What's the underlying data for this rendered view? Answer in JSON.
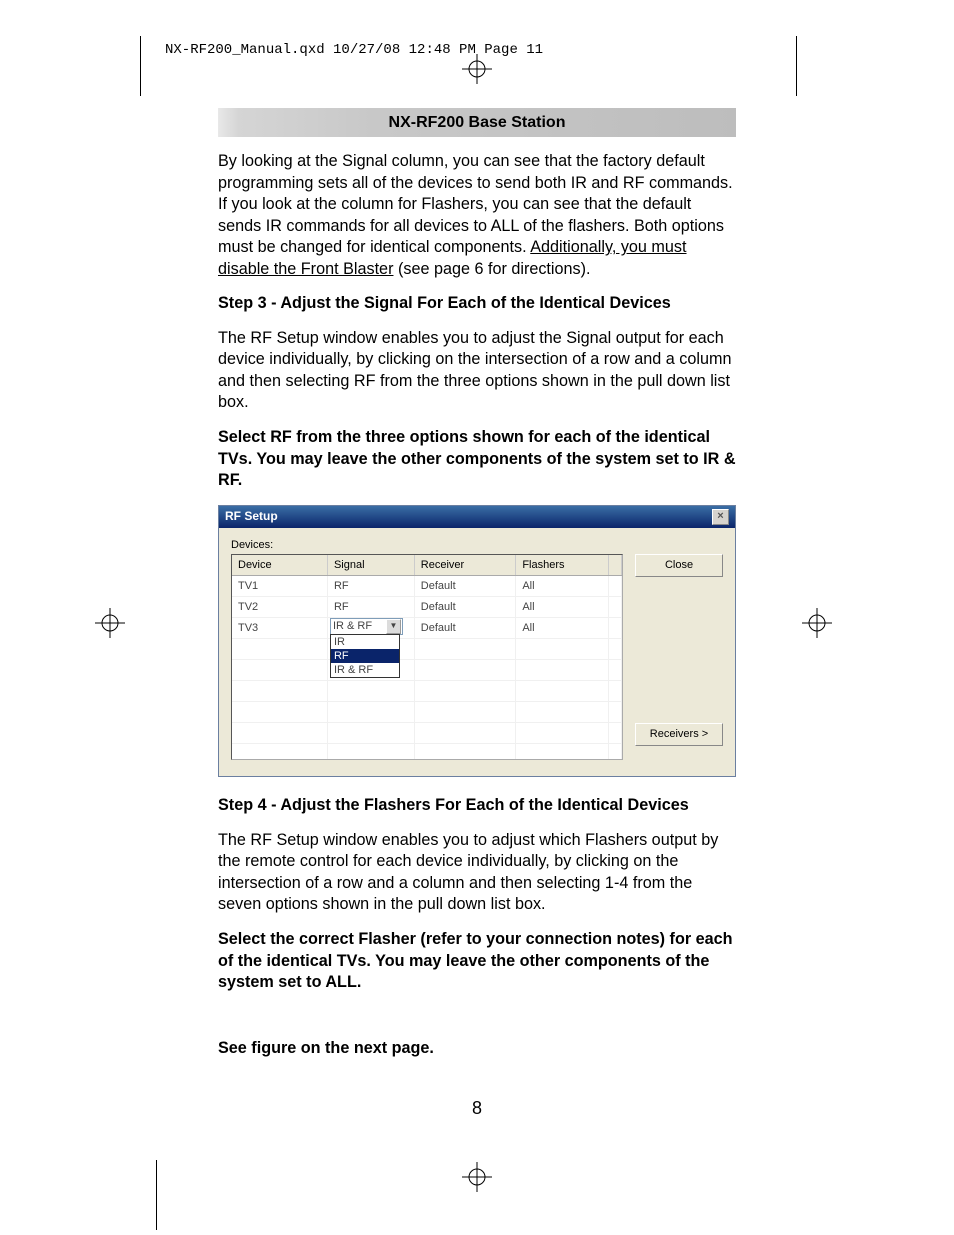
{
  "header": {
    "file_info": "NX-RF200_Manual.qxd  10/27/08  12:48 PM  Page 11"
  },
  "title_bar": "NX-RF200 Base Station",
  "para1_a": "By looking at the Signal column, you can see that the factory default programming sets all of the devices to send both IR and RF commands. If you look at the column for Flashers, you can see that the default sends IR commands for all devices to ALL of the flashers. Both options must be changed for identical components. ",
  "para1_u": "Additionally, you must disable the Front Blaster",
  "para1_b": " (see page 6 for directions).",
  "step3_heading": "Step 3 - Adjust the Signal For Each of the Identical Devices",
  "step3_para": "The RF Setup window enables you to adjust the Signal output for each device individually, by clicking on the intersection of a row and a column and then selecting RF from the three options shown in the pull down list box.",
  "step3_bold": "Select RF from the three options shown for each of the identical TVs. You may leave the other components of the system set to IR & RF.",
  "rf_window": {
    "title": "RF Setup",
    "close_x": "×",
    "devices_label": "Devices:",
    "columns": {
      "c1": "Device",
      "c2": "Signal",
      "c3": "Receiver",
      "c4": "Flashers"
    },
    "rows": [
      {
        "device": "TV1",
        "signal": "RF",
        "receiver": "Default",
        "flashers": "All"
      },
      {
        "device": "TV2",
        "signal": "RF",
        "receiver": "Default",
        "flashers": "All"
      },
      {
        "device": "TV3",
        "signal": "IR & RF",
        "receiver": "Default",
        "flashers": "All"
      }
    ],
    "dropdown": {
      "opt1": "IR",
      "opt2": "RF",
      "opt3": "IR & RF"
    },
    "close_btn": "Close",
    "receivers_btn": "Receivers >"
  },
  "step4_heading": "Step 4 - Adjust the Flashers For Each of the Identical Devices",
  "step4_para": "The RF Setup window enables you to adjust which Flashers output by the remote control for each device individually, by clicking on the intersection of a row and a column and then selecting 1-4 from the seven options shown in the pull down list box.",
  "step4_bold": "Select the correct Flasher (refer to your connection notes) for each of the identical TVs. You may leave the other components of the system set to ALL.",
  "see_figure": "See figure on the next page.",
  "page_number": "8"
}
